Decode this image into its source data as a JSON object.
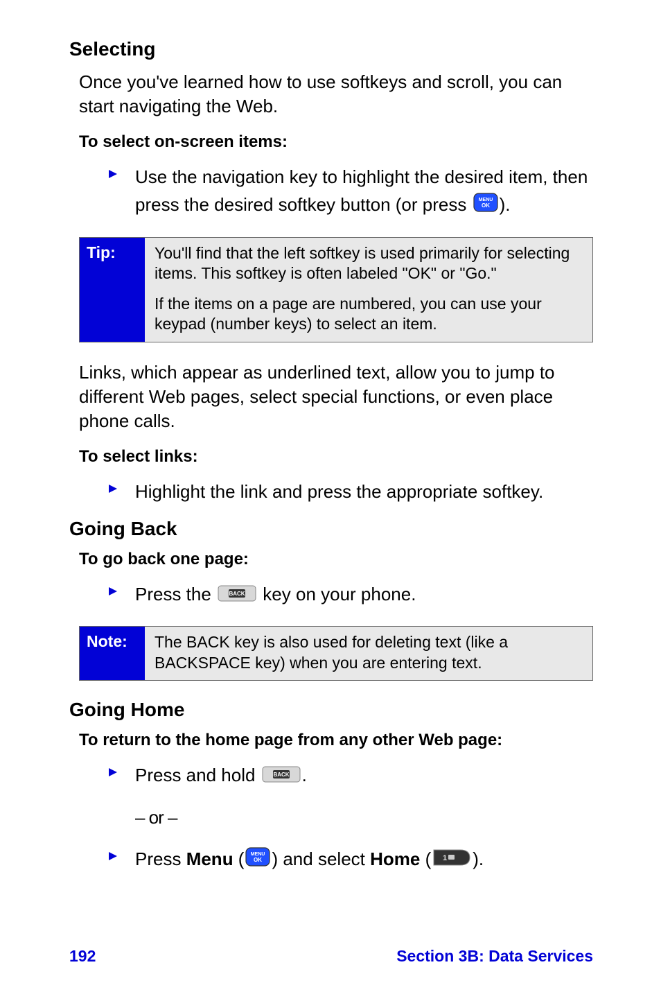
{
  "section1": {
    "heading": "Selecting",
    "intro": "Once you've learned how to use softkeys and scroll, you can start navigating the Web.",
    "subhead": "To select on-screen items:",
    "bullet_pre": "Use the navigation key to highlight the desired item, then press the desired softkey button (or press ",
    "bullet_post": ")."
  },
  "tip": {
    "label": "Tip:",
    "p1": "You'll find that the left softkey is used primarily for selecting items. This softkey is often labeled \"OK\" or \"Go.\"",
    "p2": "If the items on a page are numbered, you can use your keypad (number keys) to select an item."
  },
  "links": {
    "para": "Links, which appear as underlined text, allow you to jump to different Web pages, select special functions, or even place phone calls.",
    "subhead": "To select links:",
    "bullet": "Highlight the link and press the appropriate softkey."
  },
  "back": {
    "heading": "Going Back",
    "subhead": "To go back one page:",
    "bullet_pre": "Press the ",
    "bullet_post": " key on your phone."
  },
  "note": {
    "label": "Note:",
    "body": "The BACK key is also used for deleting text (like a BACKSPACE key) when you are entering text."
  },
  "home": {
    "heading": "Going Home",
    "subhead": "To return to the home page from any other Web page:",
    "bullet1_pre": "Press and hold ",
    "bullet1_post": ".",
    "or": "– or –",
    "bullet2_pre": "Press ",
    "bullet2_menu": "Menu",
    "bullet2_open": " (",
    "bullet2_mid": ") and select ",
    "bullet2_home": "Home",
    "bullet2_open2": " (",
    "bullet2_post": ")."
  },
  "footer": {
    "page": "192",
    "section": "Section 3B: Data Services"
  },
  "icons": {
    "menu_ok": "MENU/OK",
    "back": "BACK",
    "home": "1"
  }
}
